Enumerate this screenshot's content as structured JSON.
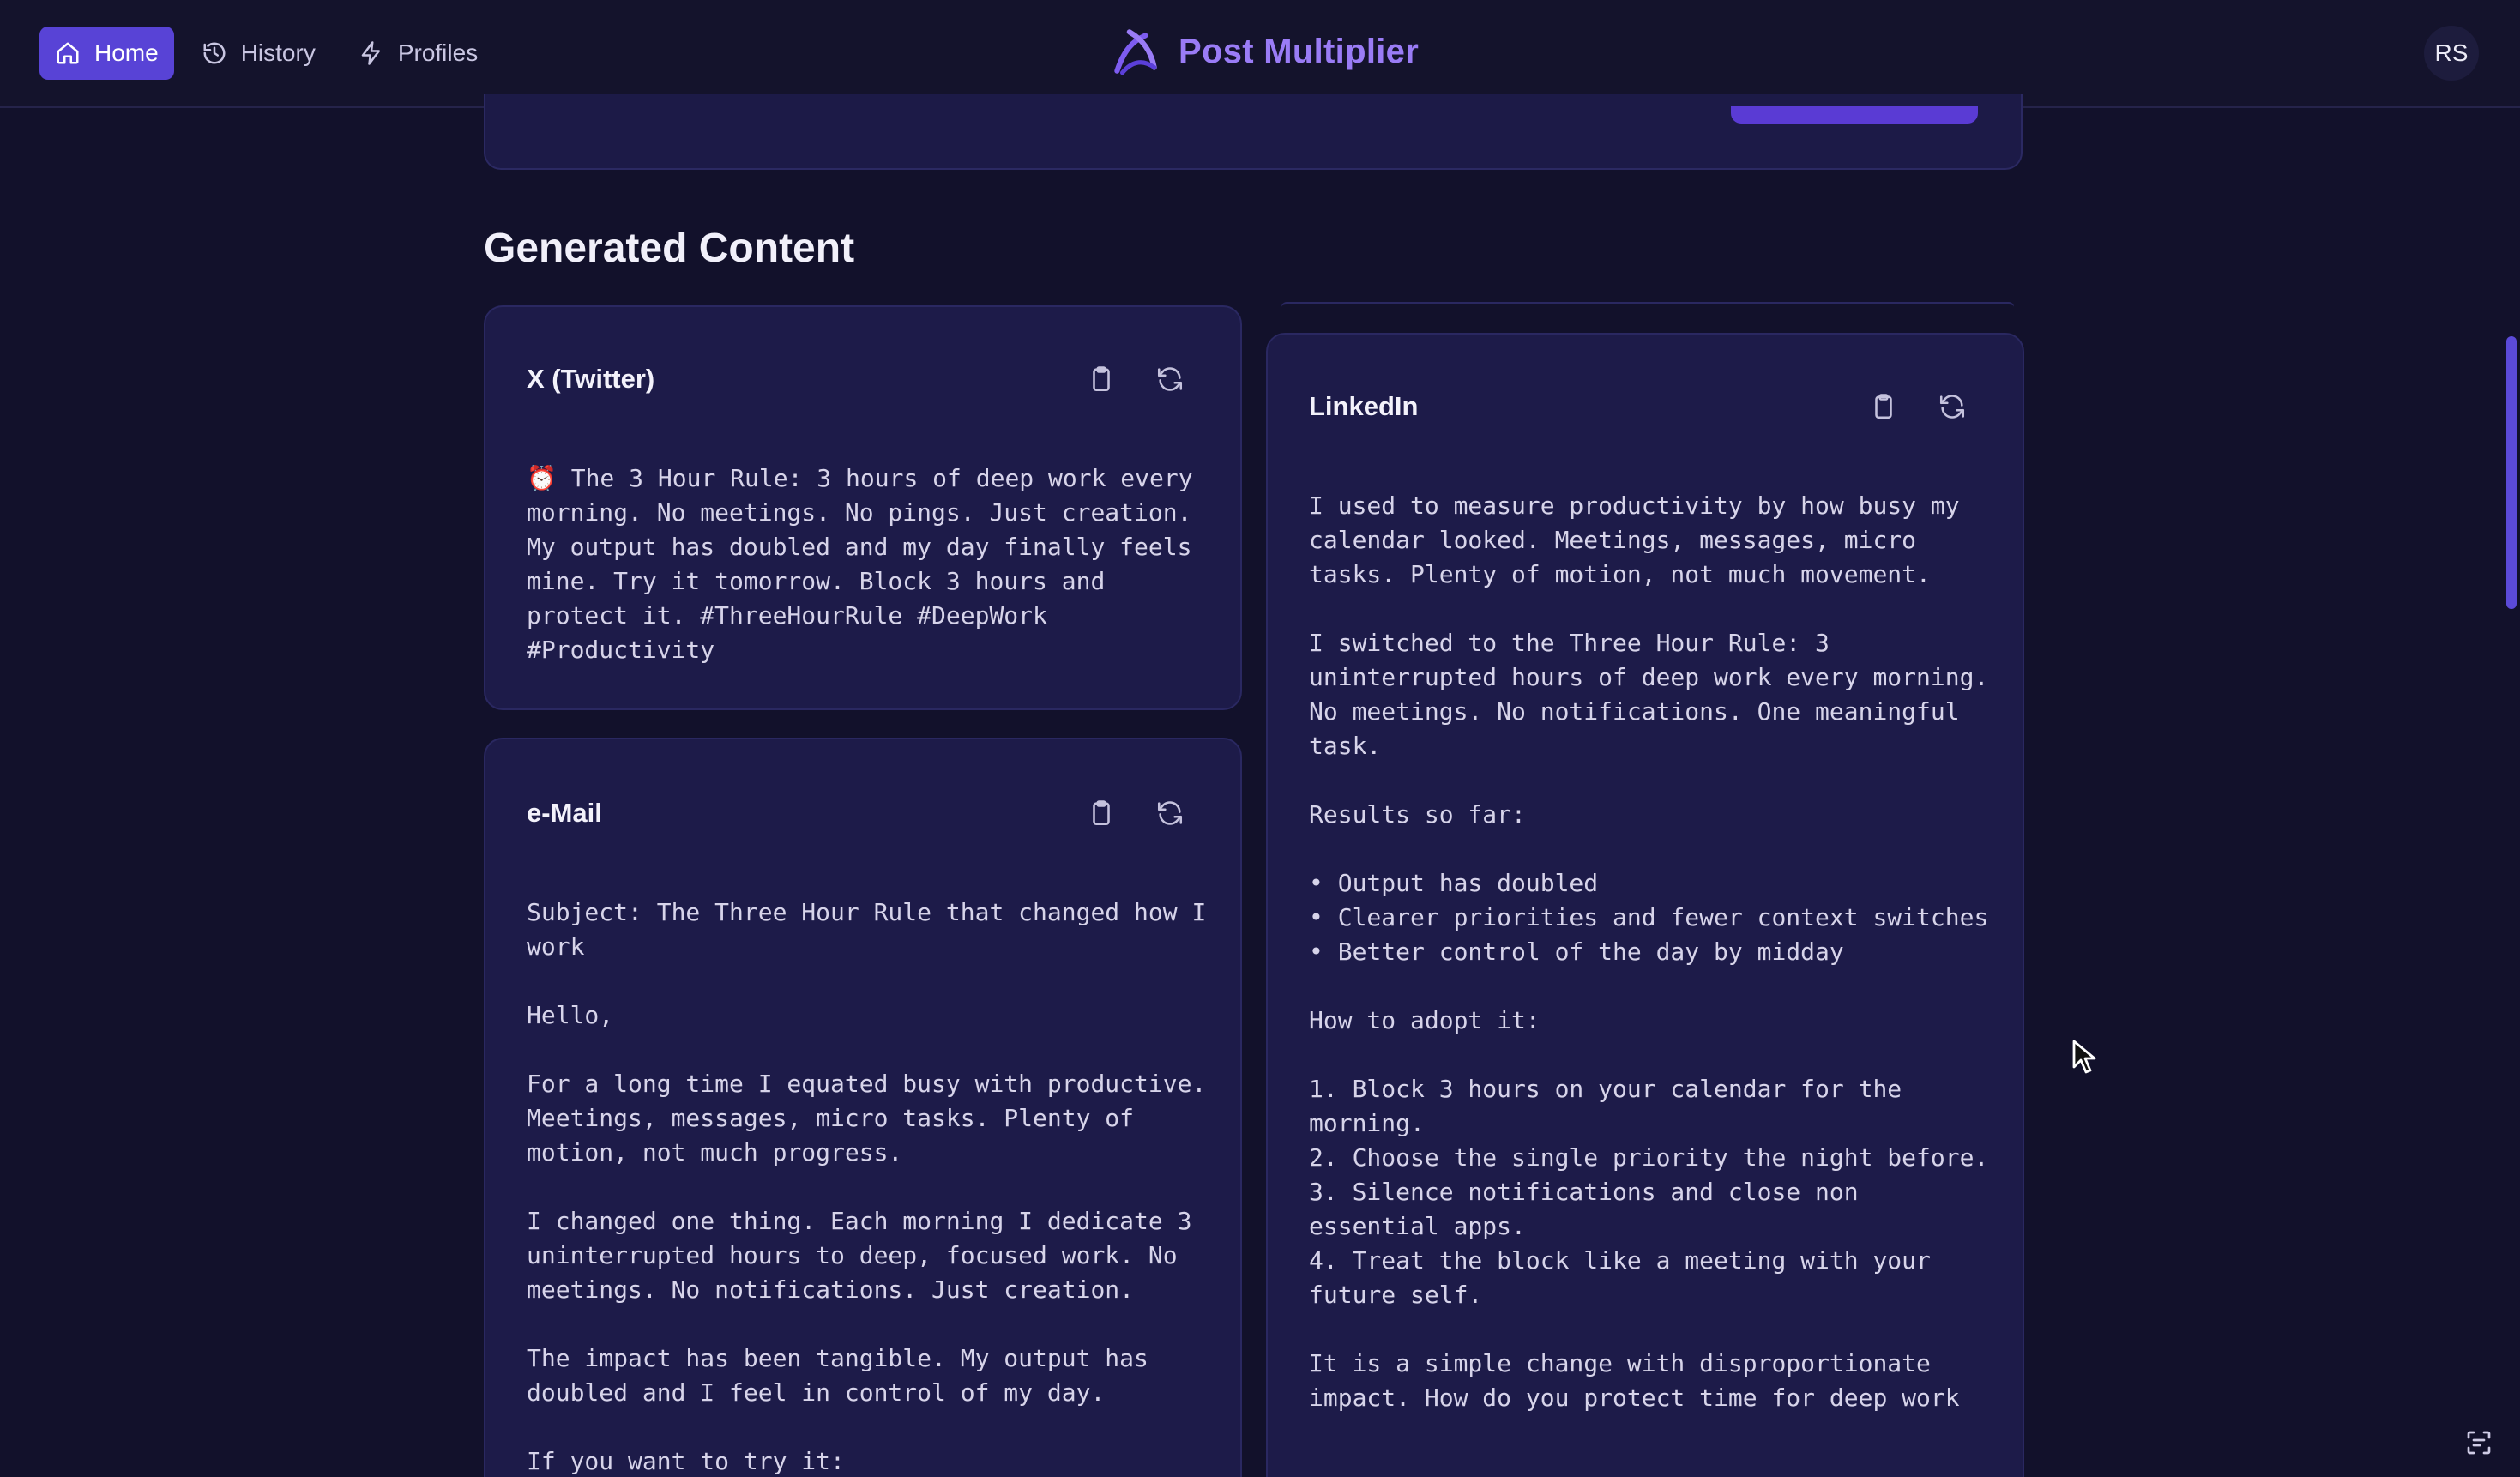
{
  "nav": {
    "items": [
      {
        "label": "Home",
        "icon": "home-icon",
        "active": true
      },
      {
        "label": "History",
        "icon": "history-icon",
        "active": false
      },
      {
        "label": "Profiles",
        "icon": "lightning-icon",
        "active": false
      }
    ]
  },
  "brand": {
    "name": "Post Multiplier",
    "logo": "post-multiplier-logo"
  },
  "user": {
    "initials": "RS"
  },
  "section": {
    "title": "Generated Content"
  },
  "cards": {
    "twitter": {
      "title": "X (Twitter)",
      "body": "⏰ The 3 Hour Rule: 3 hours of deep work every morning. No meetings. No pings. Just creation. My output has doubled and my day finally feels mine. Try it tomorrow. Block 3 hours and protect it. #ThreeHourRule #DeepWork #Productivity"
    },
    "email": {
      "title": "e-Mail",
      "body": "Subject: The Three Hour Rule that changed how I work\n\nHello,\n\nFor a long time I equated busy with productive. Meetings, messages, micro tasks. Plenty of motion, not much progress.\n\nI changed one thing. Each morning I dedicate 3 uninterrupted hours to deep, focused work. No meetings. No notifications. Just creation.\n\nThe impact has been tangible. My output has doubled and I feel in control of my day.\n\nIf you want to try it:"
    },
    "linkedin": {
      "title": "LinkedIn",
      "body": "I used to measure productivity by how busy my calendar looked. Meetings, messages, micro tasks. Plenty of motion, not much movement.\n\nI switched to the Three Hour Rule: 3 uninterrupted hours of deep work every morning. No meetings. No notifications. One meaningful task.\n\nResults so far:\n\n• Output has doubled\n• Clearer priorities and fewer context switches\n• Better control of the day by midday\n\nHow to adopt it:\n\n1. Block 3 hours on your calendar for the morning.\n2. Choose the single priority the night before.\n3. Silence notifications and close non essential apps.\n4. Treat the block like a meeting with your future self.\n\nIt is a simple change with disproportionate impact. How do you protect time for deep work"
    }
  },
  "actions": {
    "copy_icon": "clipboard-icon",
    "regenerate_icon": "refresh-icon"
  },
  "colors": {
    "accent": "#5843d6",
    "brand": "#9a7cf6",
    "background": "#12112b",
    "card": "#1d1b49"
  }
}
